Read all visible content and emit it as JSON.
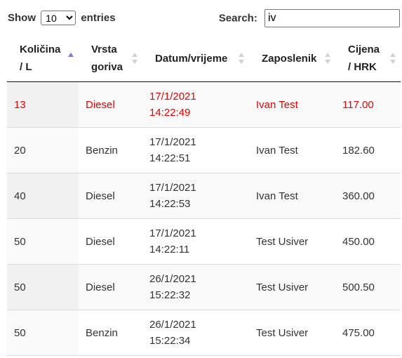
{
  "length": {
    "show_label": "Show",
    "selected": "10",
    "entries_label": "entries"
  },
  "search": {
    "label": "Search:",
    "value": "iv"
  },
  "columns": [
    {
      "line1": "Količina",
      "line2": "/ L"
    },
    {
      "line1": "Vrsta",
      "line2": "goriva"
    },
    {
      "line1": "Datum/vrijeme",
      "line2": ""
    },
    {
      "line1": "Zaposlenik",
      "line2": ""
    },
    {
      "line1": "Cijena",
      "line2": "/ HRK"
    }
  ],
  "sorted_column": 0,
  "sort_direction": "asc",
  "highlight_color": "#ee0000",
  "rows": [
    {
      "kolicina": "13",
      "vrsta": "Diesel",
      "datum": "17/1/2021",
      "vrijeme": "14:22:49",
      "zaposlenik": "Ivan Test",
      "cijena": "117.00",
      "highlight": true
    },
    {
      "kolicina": "20",
      "vrsta": "Benzin",
      "datum": "17/1/2021",
      "vrijeme": "14:22:51",
      "zaposlenik": "Ivan Test",
      "cijena": "182.60",
      "highlight": false
    },
    {
      "kolicina": "40",
      "vrsta": "Diesel",
      "datum": "17/1/2021",
      "vrijeme": "14:22:53",
      "zaposlenik": "Ivan Test",
      "cijena": "360.00",
      "highlight": false
    },
    {
      "kolicina": "50",
      "vrsta": "Diesel",
      "datum": "17/1/2021",
      "vrijeme": "14:22:11",
      "zaposlenik": "Test Usiver",
      "cijena": "450.00",
      "highlight": false
    },
    {
      "kolicina": "50",
      "vrsta": "Diesel",
      "datum": "26/1/2021",
      "vrijeme": "15:22:32",
      "zaposlenik": "Test Usiver",
      "cijena": "500.50",
      "highlight": false
    },
    {
      "kolicina": "50",
      "vrsta": "Benzin",
      "datum": "26/1/2021",
      "vrijeme": "15:22:34",
      "zaposlenik": "Test Usiver",
      "cijena": "475.00",
      "highlight": false
    }
  ]
}
